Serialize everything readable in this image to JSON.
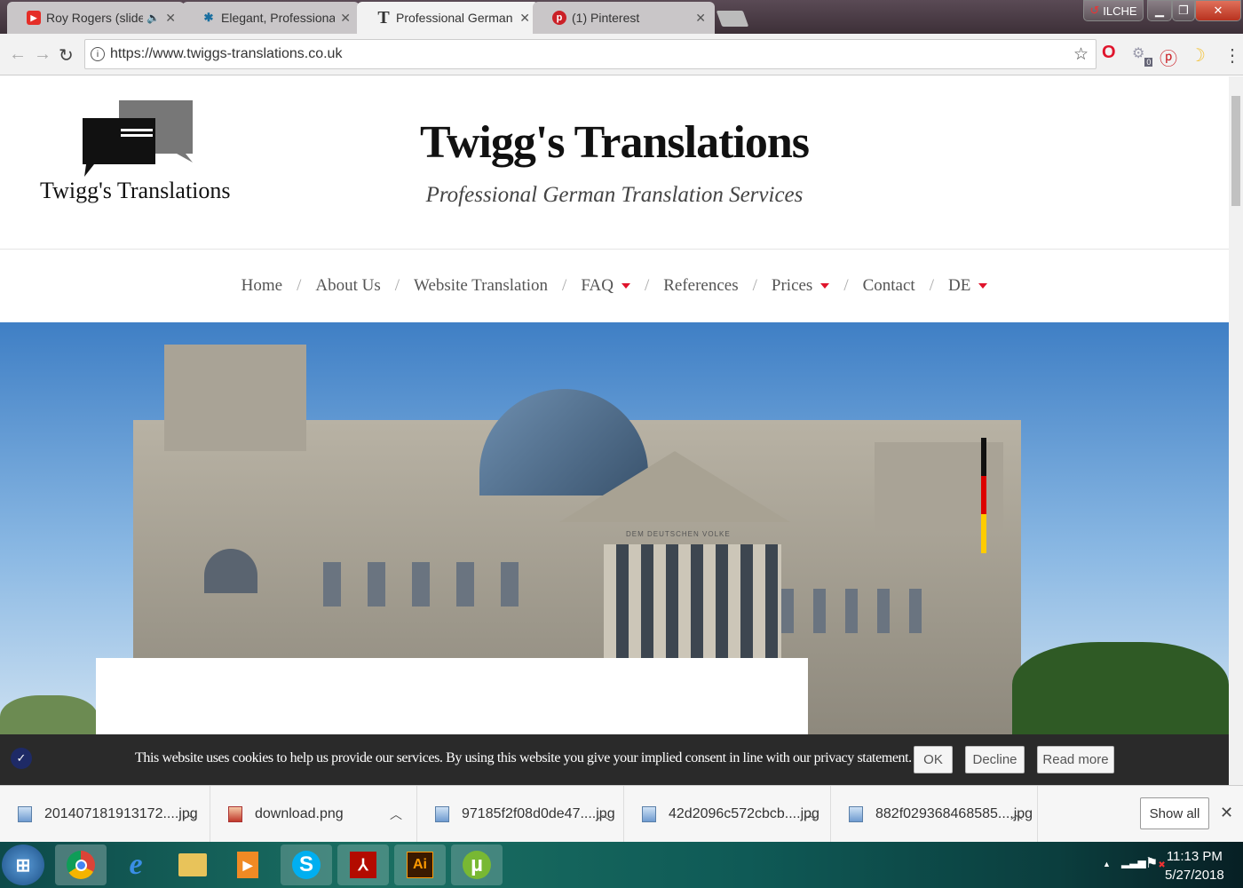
{
  "browser": {
    "tabs": [
      {
        "title": "Roy Rogers (slide guit",
        "icon": "youtube-icon",
        "audio": true
      },
      {
        "title": "Elegant, Professional Log",
        "icon": "splat-icon"
      },
      {
        "title": "Professional German Trar",
        "icon": "t-icon",
        "active": true
      },
      {
        "title": "(1) Pinterest",
        "icon": "pinterest-icon"
      }
    ],
    "profile_label": "ILCHE",
    "url": "https://www.twiggs-translations.co.uk",
    "extension_badge": "0"
  },
  "site": {
    "logo_text": "Twigg's Translations",
    "title": "Twigg's Translations",
    "tagline": "Professional German Translation Services",
    "nav": [
      {
        "label": "Home",
        "dropdown": false
      },
      {
        "label": "About Us",
        "dropdown": false
      },
      {
        "label": "Website Translation",
        "dropdown": false
      },
      {
        "label": "FAQ",
        "dropdown": true
      },
      {
        "label": "References",
        "dropdown": false
      },
      {
        "label": "Prices",
        "dropdown": true
      },
      {
        "label": "Contact",
        "dropdown": false
      },
      {
        "label": "DE",
        "dropdown": true
      }
    ],
    "nav_separator": "/",
    "hero_inscription": "DEM DEUTSCHEN VOLKE",
    "accent_color": "#e0142c"
  },
  "cookie_bar": {
    "text": "This website uses cookies to help us provide our services. By using this website you give your implied consent in line with our privacy statement.",
    "ok": "OK",
    "decline": "Decline",
    "read_more": "Read more"
  },
  "downloads": {
    "items": [
      "201407181913172....jpg",
      "download.png",
      "97185f2f08d0de47....jpg",
      "42d2096c572cbcb....jpg",
      "882f029368468585....jpg"
    ],
    "show_all": "Show all"
  },
  "taskbar": {
    "apps": [
      "start",
      "chrome",
      "internet-explorer",
      "file-explorer",
      "media-player",
      "skype",
      "acrobat",
      "illustrator",
      "utorrent"
    ],
    "time": "11:13 PM",
    "date": "5/27/2018"
  }
}
